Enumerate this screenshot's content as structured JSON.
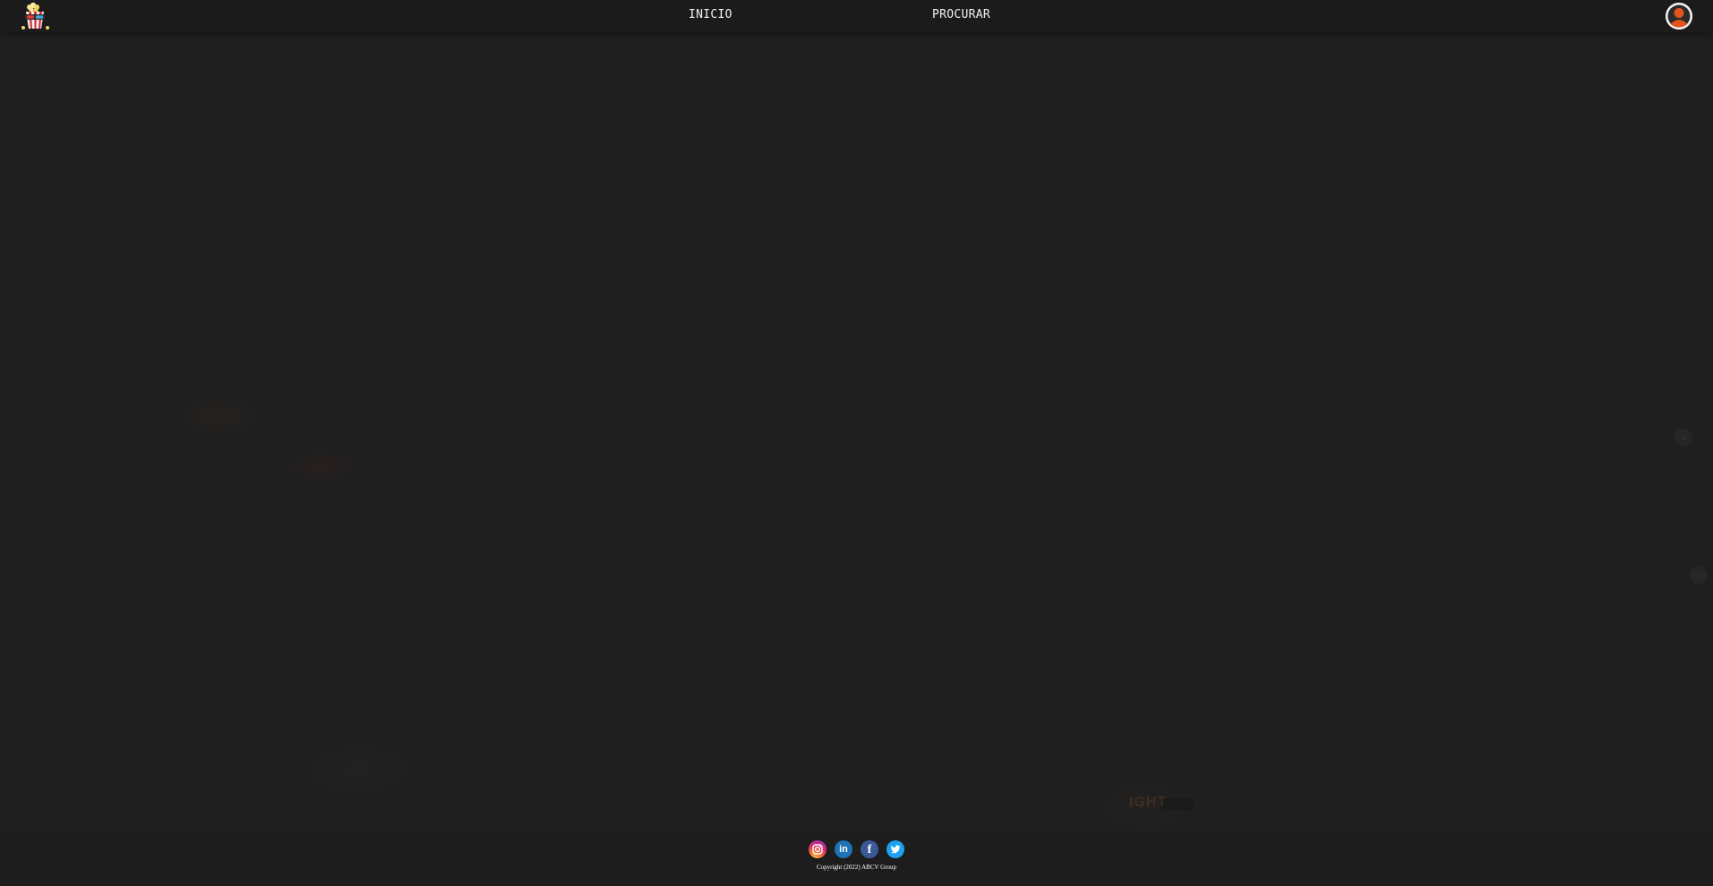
{
  "header": {
    "logo_icon": "popcorn-3d-glasses-icon",
    "nav": [
      {
        "label": "INICIO"
      },
      {
        "label": "PROCURAR"
      }
    ],
    "avatar_icon": "user-avatar-icon"
  },
  "carousel": {
    "prev_icon": "chevron-left-icon",
    "next_icon": "chevron-right-icon",
    "background_partial_text": "IGHT"
  },
  "footer": {
    "social": [
      {
        "icon": "instagram-icon",
        "color": "#d6287a"
      },
      {
        "icon": "linkedin-icon",
        "label": "in",
        "color": "#1e73b4"
      },
      {
        "icon": "facebook-icon",
        "label": "f",
        "color": "#3b5998"
      },
      {
        "icon": "twitter-icon",
        "color": "#1da1f2"
      }
    ],
    "copyright": "Copyright (2022) ABCV Group"
  },
  "theme": {
    "background": "#1f1f1f",
    "header_bg": "#1b1b1b",
    "text": "#f2f2f2",
    "avatar_accent": "#e2541b"
  }
}
